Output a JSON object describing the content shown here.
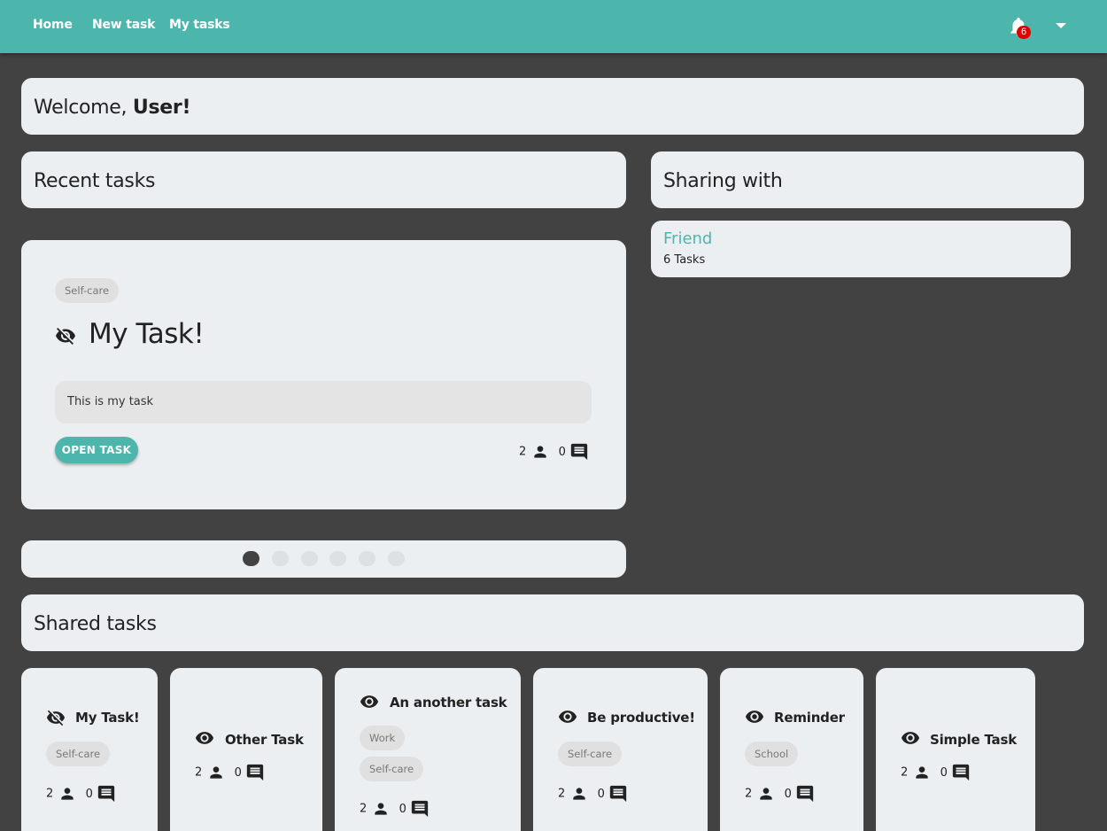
{
  "nav": {
    "home": "Home",
    "new_task": "New task",
    "my_tasks": "My tasks",
    "notification_count": "6"
  },
  "welcome": {
    "prefix": "Welcome, ",
    "user": "User!"
  },
  "recent": {
    "title": "Recent tasks"
  },
  "sharing": {
    "title": "Sharing with",
    "friend": {
      "name": "Friend",
      "count": "6 Tasks"
    }
  },
  "featured_task": {
    "tag": "Self-care",
    "title": "My Task!",
    "visibility_icon": "eye-off-icon",
    "description": "This is my task",
    "open_label": "OPEN TASK",
    "people": "2",
    "comments": "0"
  },
  "carousel": {
    "count": 6,
    "active": 0
  },
  "shared": {
    "title": "Shared tasks",
    "tasks": [
      {
        "title": "My Task!",
        "icon": "eye-off-icon",
        "tags": [
          "Self-care"
        ],
        "people": "2",
        "comments": "0"
      },
      {
        "title": "Other Task",
        "icon": "eye-icon",
        "tags": [],
        "people": "2",
        "comments": "0"
      },
      {
        "title": "An another task",
        "icon": "eye-icon",
        "tags": [
          "Work",
          "Self-care"
        ],
        "people": "2",
        "comments": "0"
      },
      {
        "title": "Be productive!",
        "icon": "eye-icon",
        "tags": [
          "Self-care"
        ],
        "people": "2",
        "comments": "0"
      },
      {
        "title": "Reminder",
        "icon": "eye-icon",
        "tags": [
          "School"
        ],
        "people": "2",
        "comments": "0"
      },
      {
        "title": "Simple Task",
        "icon": "eye-icon",
        "tags": [],
        "people": "2",
        "comments": "0"
      }
    ]
  },
  "colors": {
    "accent": "#4db6ac",
    "background": "#424242",
    "card": "#eceff1",
    "badge": "#e00000"
  }
}
